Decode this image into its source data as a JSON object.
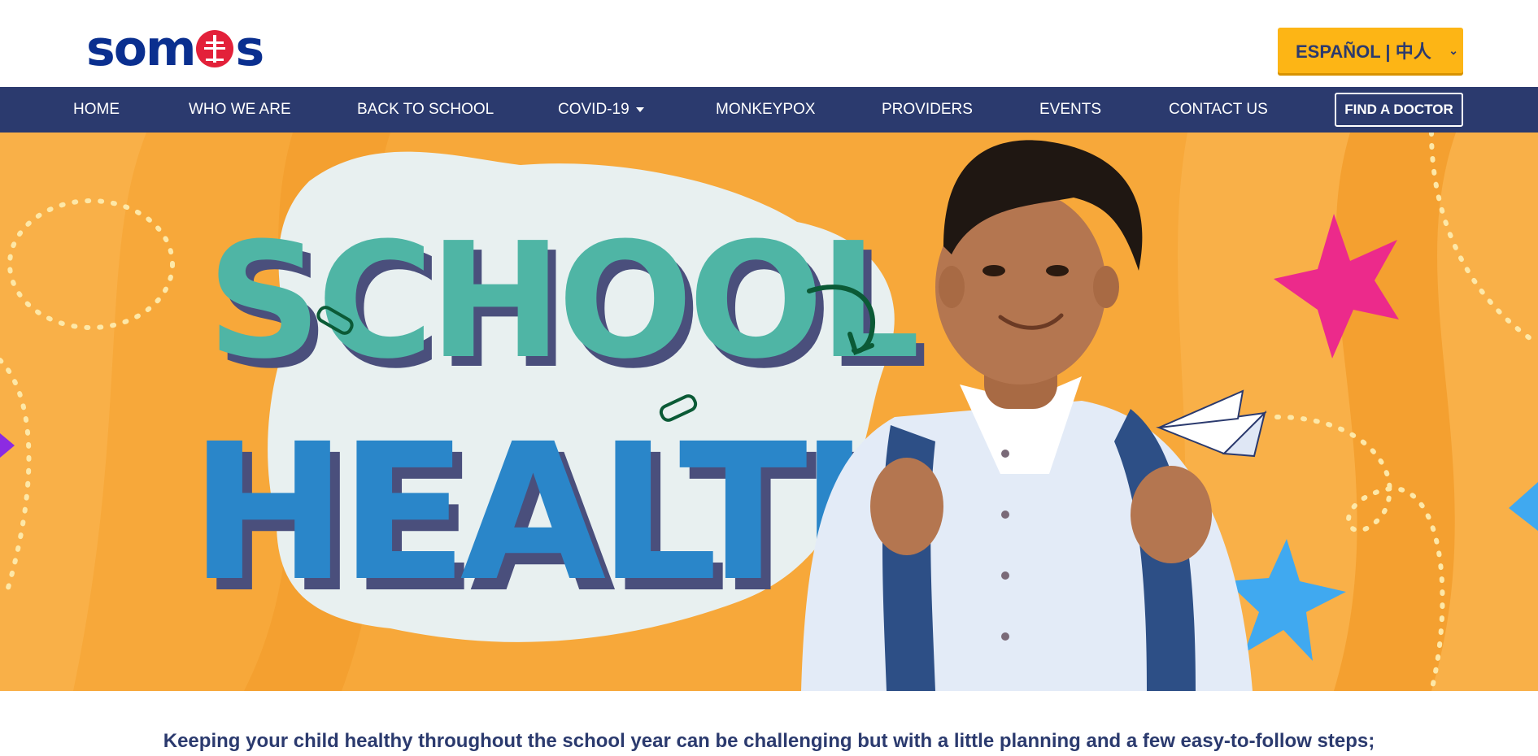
{
  "brand": {
    "name": "somos",
    "primary": "#0a2f8f",
    "accent": "#e3213a"
  },
  "language_selector": {
    "label": "ESPAÑOL | 中人",
    "icon": "chevron-down-icon",
    "color": "#fdb515"
  },
  "nav": {
    "background": "#2b3a6e",
    "items": [
      {
        "label": "HOME"
      },
      {
        "label": "WHO WE ARE"
      },
      {
        "label": "BACK TO SCHOOL"
      },
      {
        "label": "COVID-19",
        "has_dropdown": true
      },
      {
        "label": "MONKEYPOX"
      },
      {
        "label": "PROVIDERS"
      },
      {
        "label": "EVENTS"
      },
      {
        "label": "CONTACT US"
      }
    ],
    "cta": {
      "label": "FIND A DOCTOR"
    }
  },
  "hero": {
    "title_line1": "SCHOOL",
    "title_line2": "HEALTH",
    "background": "#f7a83a"
  },
  "intro": {
    "text": "Keeping your child healthy throughout the school year can be challenging but with a little planning and a few easy-to-follow steps;"
  }
}
